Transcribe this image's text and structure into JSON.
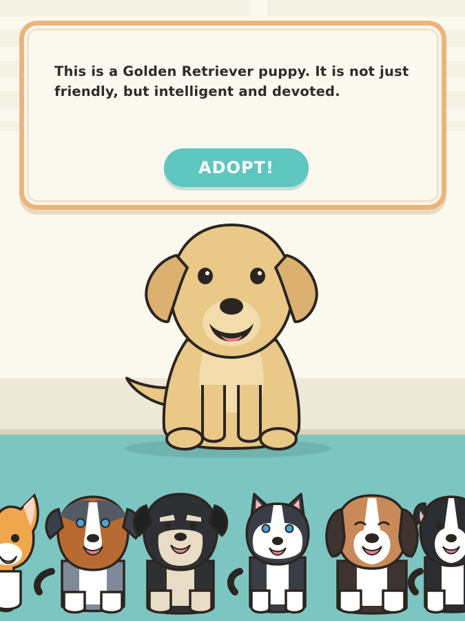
{
  "dialog": {
    "text": "This is a Golden Retriever puppy. It is not just friendly, but intelligent and devoted.",
    "adopt_label": "ADOPT!"
  },
  "featured_puppy": {
    "breed": "Golden Retriever",
    "icon": "golden-retriever-puppy-icon"
  },
  "puppy_strip": [
    {
      "icon": "corgi-puppy-icon"
    },
    {
      "icon": "australian-shepherd-puppy-icon"
    },
    {
      "icon": "schnauzer-puppy-icon"
    },
    {
      "icon": "husky-puppy-icon"
    },
    {
      "icon": "beagle-puppy-icon"
    },
    {
      "icon": "border-collie-puppy-icon"
    }
  ],
  "colors": {
    "dialog_border": "#eab57d",
    "button": "#5fc6c0",
    "floor": "#7dc5c1",
    "wall": "#fbf8ee"
  }
}
